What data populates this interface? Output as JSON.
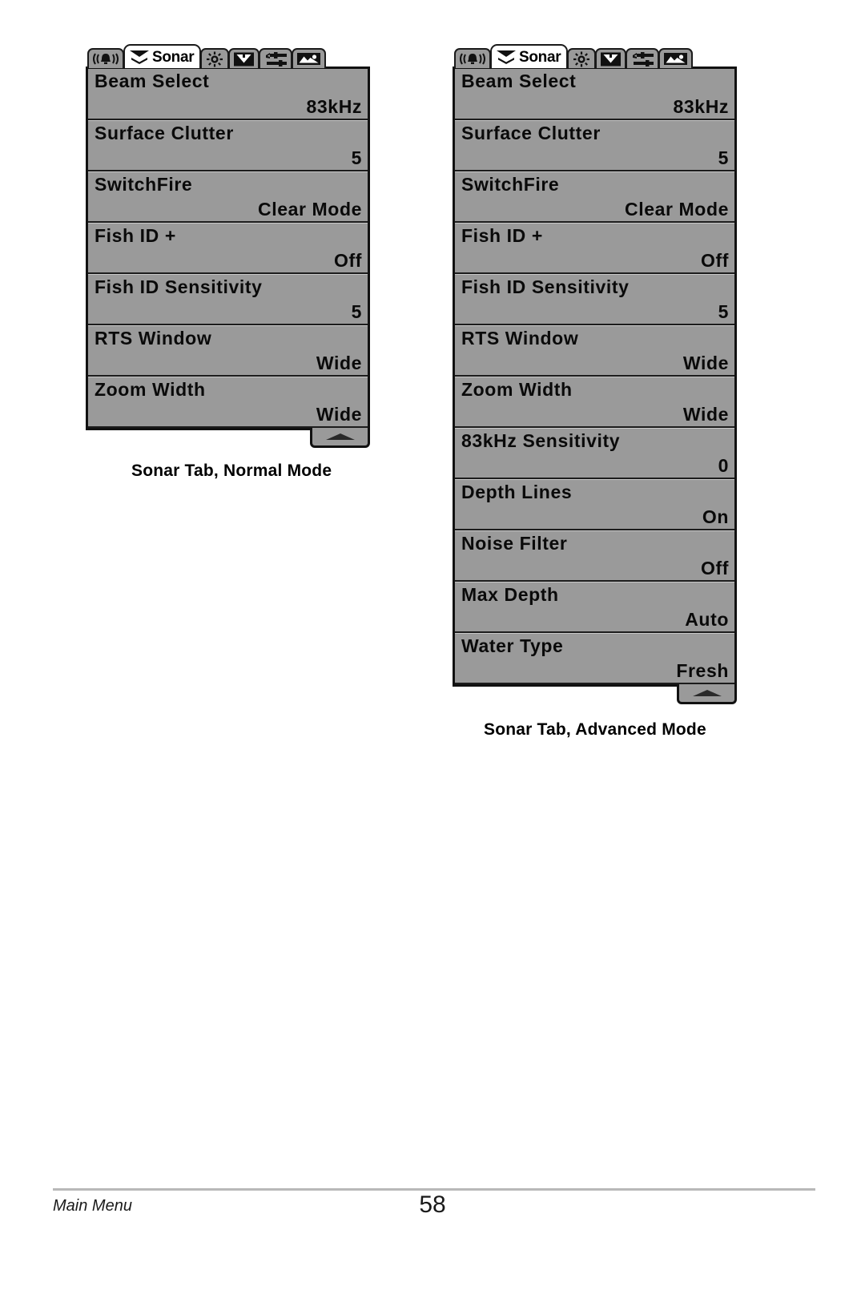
{
  "page": {
    "footer_section": "Main Menu",
    "page_number": "58",
    "background": "#ffffff"
  },
  "colors": {
    "screen_bg": "#9a9a9a",
    "screen_border": "#111111",
    "active_tab_bg": "#ffffff",
    "text": "#0a0a0a"
  },
  "tabs": [
    {
      "name": "alarm-tab",
      "icon": "alarm-bell-icon",
      "label": "",
      "active": false
    },
    {
      "name": "sonar-tab",
      "icon": "sonar-cone-icon",
      "label": "Sonar",
      "active": true
    },
    {
      "name": "setup-brightness-tab",
      "icon": "sun-brightness-icon",
      "label": "",
      "active": false
    },
    {
      "name": "navigation-tab",
      "icon": "chart-cone-icon",
      "label": "",
      "active": false
    },
    {
      "name": "setup-tab",
      "icon": "wrench-sliders-icon",
      "label": "",
      "active": false
    },
    {
      "name": "views-tab",
      "icon": "landscape-view-icon",
      "label": "",
      "active": false
    }
  ],
  "panels": [
    {
      "id": "normal",
      "caption": "Sonar Tab, Normal Mode",
      "scroll_more_icon": "scroll-up-arrow-icon",
      "items": [
        {
          "label": "Beam Select",
          "value": "83kHz"
        },
        {
          "label": "Surface Clutter",
          "value": "5"
        },
        {
          "label": "SwitchFire",
          "value": "Clear Mode"
        },
        {
          "label": "Fish ID +",
          "value": "Off"
        },
        {
          "label": "Fish ID Sensitivity",
          "value": "5"
        },
        {
          "label": "RTS Window",
          "value": "Wide"
        },
        {
          "label": "Zoom Width",
          "value": "Wide"
        }
      ]
    },
    {
      "id": "advanced",
      "caption": "Sonar Tab, Advanced Mode",
      "scroll_more_icon": "scroll-up-arrow-icon",
      "items": [
        {
          "label": "Beam Select",
          "value": "83kHz"
        },
        {
          "label": "Surface Clutter",
          "value": "5"
        },
        {
          "label": "SwitchFire",
          "value": "Clear Mode"
        },
        {
          "label": "Fish ID +",
          "value": "Off"
        },
        {
          "label": "Fish ID Sensitivity",
          "value": "5"
        },
        {
          "label": "RTS Window",
          "value": "Wide"
        },
        {
          "label": "Zoom Width",
          "value": "Wide"
        },
        {
          "label": "83kHz Sensitivity",
          "value": "0"
        },
        {
          "label": "Depth Lines",
          "value": "On"
        },
        {
          "label": "Noise Filter",
          "value": "Off"
        },
        {
          "label": "Max Depth",
          "value": "Auto"
        },
        {
          "label": "Water Type",
          "value": "Fresh"
        }
      ]
    }
  ]
}
